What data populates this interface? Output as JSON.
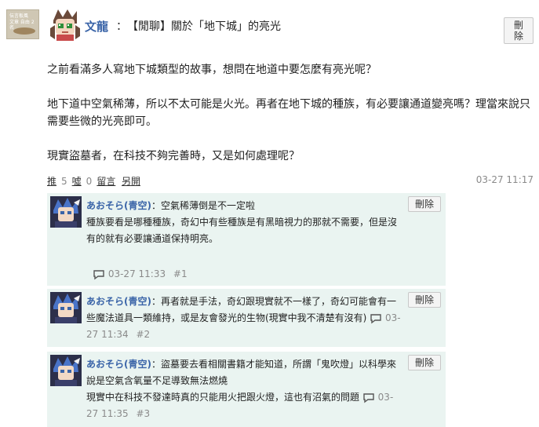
{
  "post": {
    "board_thumb_line1": "伝言板風",
    "board_thumb_line2": "文章 自由 2名",
    "author": "文龍",
    "separator": "：",
    "title": "【閒聊】關於「地下城」的亮光",
    "delete_label": "刪除",
    "body": [
      "之前看滿多人寫地下城類型的故事，想問在地道中要怎麼有亮光呢？",
      "地下道中空氣稀薄，所以不太可能是火光。再者在地下城的種族，有必要讓通道變亮嗎？理當來說只需要些微的光亮即可。",
      "現實盜墓者，在科技不夠完善時，又是如何處理呢？"
    ],
    "actions": {
      "push_label": "推",
      "push_count": "5",
      "boo_label": "噓",
      "boo_count": "0",
      "reply_label": "留言",
      "fold_label": "另開"
    },
    "timestamp": "03-27 11:17"
  },
  "comments": [
    {
      "author": "あおそら(青空)",
      "text_line1": "：空氣稀薄倒是不一定啦",
      "text_rest": "種族要看是哪種種族，奇幻中有些種族是有黑暗視力的那就不需要，但是沒有的就有必要讓通道保持明亮。",
      "time": "03-27 11:33",
      "floor": "#1",
      "delete_label": "刪除",
      "icon_color": "#3a64a8"
    },
    {
      "author": "あおそら(青空)",
      "text_line1": "：再者就是手法，奇幻跟現實就不一樣了，奇幻可能會有一些魔法道具一類維持，或是友會發光的生物(現實中我不清楚有沒有)",
      "text_rest": "",
      "time": "03-27 11:34",
      "floor": "#2",
      "delete_label": "刪除",
      "icon_color": "#3a64a8"
    },
    {
      "author": "あおそら(青空)",
      "text_line1": "：盜墓要去看相關書籍才能知道，所謂「鬼吹燈」以科學來說是空氣含氧量不足導致無法燃燒",
      "text_rest": "現實中在科技不發達時真的只能用火把跟火燈，這也有沼氣的問題",
      "time": "03-27 11:35",
      "floor": "#3",
      "delete_label": "刪除",
      "icon_color": "#3a64a8"
    }
  ]
}
